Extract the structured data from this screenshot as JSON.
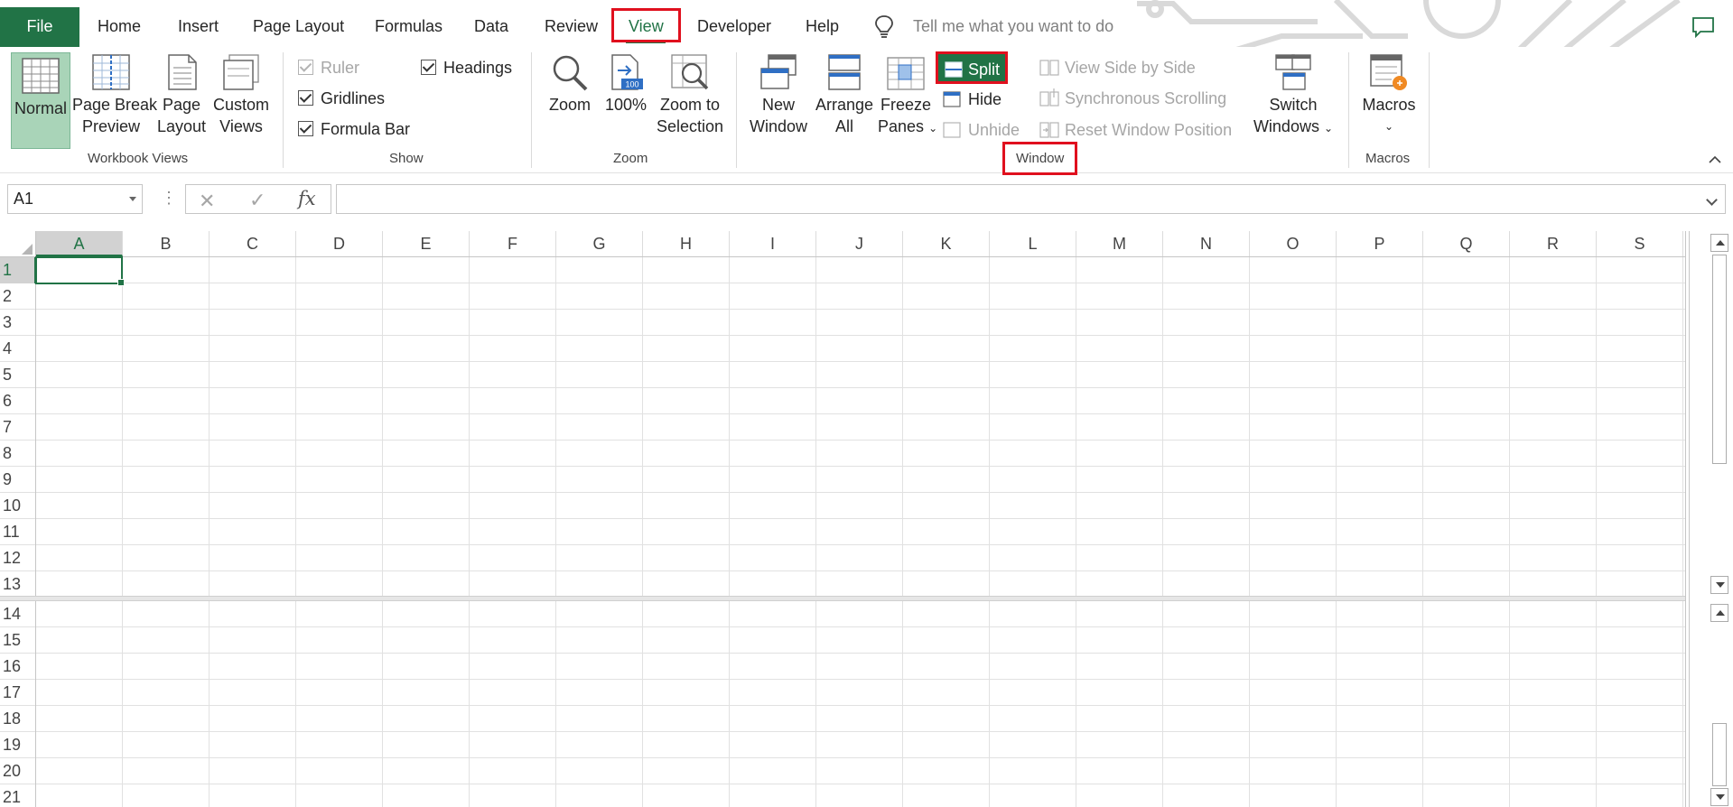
{
  "tabs": {
    "file": "File",
    "home": "Home",
    "insert": "Insert",
    "page_layout": "Page Layout",
    "formulas": "Formulas",
    "data": "Data",
    "review": "Review",
    "view": "View",
    "developer": "Developer",
    "help": "Help"
  },
  "tell_me": {
    "placeholder": "Tell me what you want to do"
  },
  "ribbon": {
    "workbook_views": {
      "label": "Workbook Views",
      "normal": "Normal",
      "page_break_1": "Page Break",
      "page_break_2": "Preview",
      "page_layout_1": "Page",
      "page_layout_2": "Layout",
      "custom_views_1": "Custom",
      "custom_views_2": "Views"
    },
    "show": {
      "label": "Show",
      "ruler": "Ruler",
      "gridlines": "Gridlines",
      "formula_bar": "Formula Bar",
      "headings": "Headings",
      "ruler_checked": true,
      "gridlines_checked": true,
      "formula_bar_checked": true,
      "headings_checked": true
    },
    "zoom": {
      "label": "Zoom",
      "zoom": "Zoom",
      "hundred": "100%",
      "hundred_icon_text": "100",
      "zoom_sel_1": "Zoom to",
      "zoom_sel_2": "Selection"
    },
    "window": {
      "label": "Window",
      "new_window_1": "New",
      "new_window_2": "Window",
      "arrange_1": "Arrange",
      "arrange_2": "All",
      "freeze_1": "Freeze",
      "freeze_2": "Panes",
      "split": "Split",
      "hide": "Hide",
      "unhide": "Unhide",
      "side_by_side": "View Side by Side",
      "sync_scroll": "Synchronous Scrolling",
      "reset_pos": "Reset Window Position",
      "switch_1": "Switch",
      "switch_2": "Windows"
    },
    "macros": {
      "label": "Macros",
      "macros": "Macros"
    }
  },
  "formula_bar": {
    "name_box": "A1",
    "fx": "fx",
    "value": ""
  },
  "grid": {
    "columns": [
      "A",
      "B",
      "C",
      "D",
      "E",
      "F",
      "G",
      "H",
      "I",
      "J",
      "K",
      "L",
      "M",
      "N",
      "O",
      "P",
      "Q",
      "R",
      "S"
    ],
    "top_rows": [
      "1",
      "2",
      "3",
      "4",
      "5",
      "6",
      "7",
      "8",
      "9",
      "10",
      "11",
      "12",
      "13"
    ],
    "bottom_rows": [
      "14",
      "15",
      "16",
      "17",
      "18",
      "19",
      "20",
      "21"
    ],
    "active_cell": "A1"
  },
  "colors": {
    "excel_green": "#217346",
    "highlight_red": "#e0101e",
    "selected_button": "#a9d4b8"
  }
}
